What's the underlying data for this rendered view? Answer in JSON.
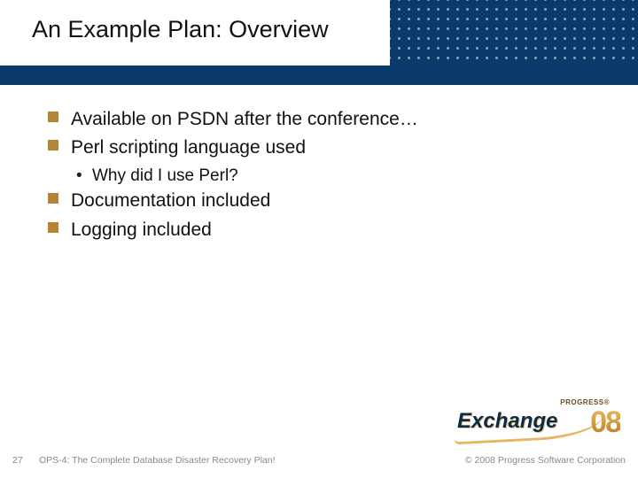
{
  "header": {
    "title": "An Example Plan: Overview"
  },
  "bullets": {
    "b1": "Available on PSDN after the conference…",
    "b2": "Perl scripting language used",
    "b2a": "Why did I use Perl?",
    "b3": "Documentation included",
    "b4": "Logging included"
  },
  "footer": {
    "page": "27",
    "text": "OPS-4: The Complete Database Disaster Recovery Plan!",
    "copyright": "© 2008 Progress Software Corporation"
  },
  "logo": {
    "tag": "PROGRESS®",
    "word": "Exchange",
    "year": "08"
  }
}
